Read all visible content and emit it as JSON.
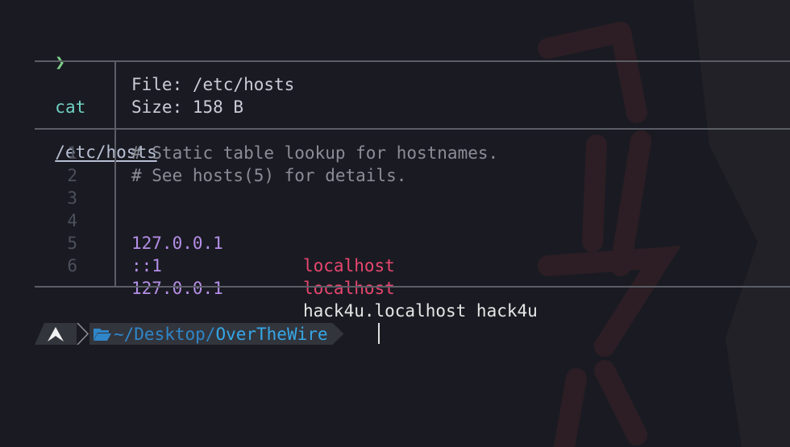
{
  "prompt": {
    "chevron": "❯",
    "command": "cat",
    "argument": "/etc/hosts"
  },
  "header": {
    "file_line": "File: /etc/hosts",
    "size_line": "Size: 158 B"
  },
  "file_lines": [
    {
      "num": "1",
      "comment": "# Static table lookup for hostnames."
    },
    {
      "num": "2",
      "comment": "# See hosts(5) for details."
    },
    {
      "num": "3"
    },
    {
      "num": "4",
      "ip": "127.0.0.1",
      "host": "localhost"
    },
    {
      "num": "5",
      "ip": "::1",
      "host": "localhost"
    },
    {
      "num": "6",
      "ip": "127.0.0.1",
      "host": "hack4u.localhost hack4u"
    }
  ],
  "ps1": {
    "os_icon": "arch-linux-icon",
    "folder_icon": "folder-open-icon",
    "path_prefix": "~/Desktop/",
    "path_last": "OverTheWire"
  },
  "colors": {
    "background": "#1a1b22",
    "ip": "#b58ee8",
    "host_localhost": "#e8466f",
    "prompt_chevron": "#7ed08a",
    "path": "#35a7e8"
  }
}
